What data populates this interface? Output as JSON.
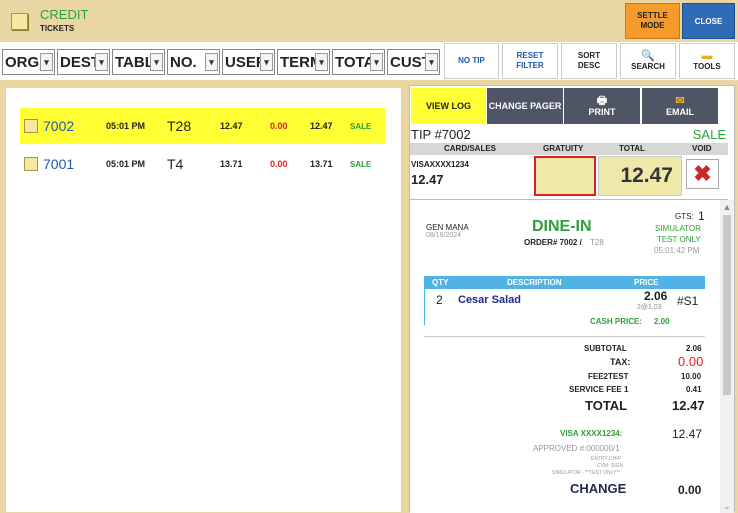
{
  "header": {
    "title": "CREDIT",
    "subtitle": "TICKETS",
    "settle_mode": "SETTLE MODE",
    "close": "CLOSE"
  },
  "filters": [
    {
      "label": "ORG"
    },
    {
      "label": "DEST"
    },
    {
      "label": "TABL"
    },
    {
      "label": "NO."
    },
    {
      "label": "USER"
    },
    {
      "label": "TERM"
    },
    {
      "label": "TOTA"
    },
    {
      "label": "CUST"
    }
  ],
  "toolbar": {
    "no_tip": "NO TIP",
    "reset_filter": "RESET FILTER",
    "sort_desc": "SORT DESC",
    "search": "SEARCH",
    "tools": "TOOLS"
  },
  "tickets": [
    {
      "number": "7002",
      "time": "05:01 PM",
      "table": "T28",
      "amount": "12.47",
      "tip": "0.00",
      "total": "12.47",
      "status": "SALE",
      "selected": true
    },
    {
      "number": "7001",
      "time": "05:01 PM",
      "table": "T4",
      "amount": "13.71",
      "tip": "0.00",
      "total": "13.71",
      "status": "SALE",
      "selected": false
    }
  ],
  "detail": {
    "tabs": {
      "view_log": "VIEW LOG",
      "change_pager": "CHANGE PAGER",
      "print": "PRINT",
      "email": "EMAIL"
    },
    "tip_no": "TIP #7002",
    "status": "SALE",
    "columns": {
      "card_sales": "CARD/SALES",
      "gratuity": "GRATUITY",
      "total": "TOTAL",
      "void": "VOID"
    },
    "card": "VISAXXXX1234",
    "card_amount": "12.47",
    "total": "12.47",
    "void_symbol": "✖"
  },
  "receipt": {
    "server": "GEN MANA",
    "date": "08/16/2024",
    "order_type": "DINE-IN",
    "order_label": "ORDER# 7002 /",
    "order_table": "T28",
    "gts_label": "GTS:",
    "gts_value": "1",
    "simulator": "SIMULATOR",
    "test_only": "TEST ONLY",
    "time": "05:01:42 PM",
    "item_headers": {
      "qty": "QTY",
      "description": "DESCRIPTION",
      "price": "PRICE"
    },
    "items": [
      {
        "qty": "2",
        "name": "Cesar Salad",
        "price": "2.06",
        "unit": "2@1.03",
        "seat": "#S1"
      }
    ],
    "cash_price_label": "CASH PRICE:",
    "cash_price": "2.00",
    "subtotal_label": "SUBTOTAL",
    "subtotal": "2.06",
    "tax_label": "TAX:",
    "tax": "0.00",
    "fee_label": "FEE2TEST",
    "fee": "10.00",
    "service_label": "SERVICE FEE 1",
    "service": "0.41",
    "total_label": "TOTAL",
    "total": "12.47",
    "payment_label": "VISA XXXX1234:",
    "payment": "12.47",
    "approved": "APPROVED #:000000/1",
    "entry": "ENTRY:CHIP",
    "cvm": "CVM: SIGN",
    "sim_note": "SIMULATOR - **TEST ONLY**",
    "change_label": "CHANGE",
    "change": "0.00"
  }
}
